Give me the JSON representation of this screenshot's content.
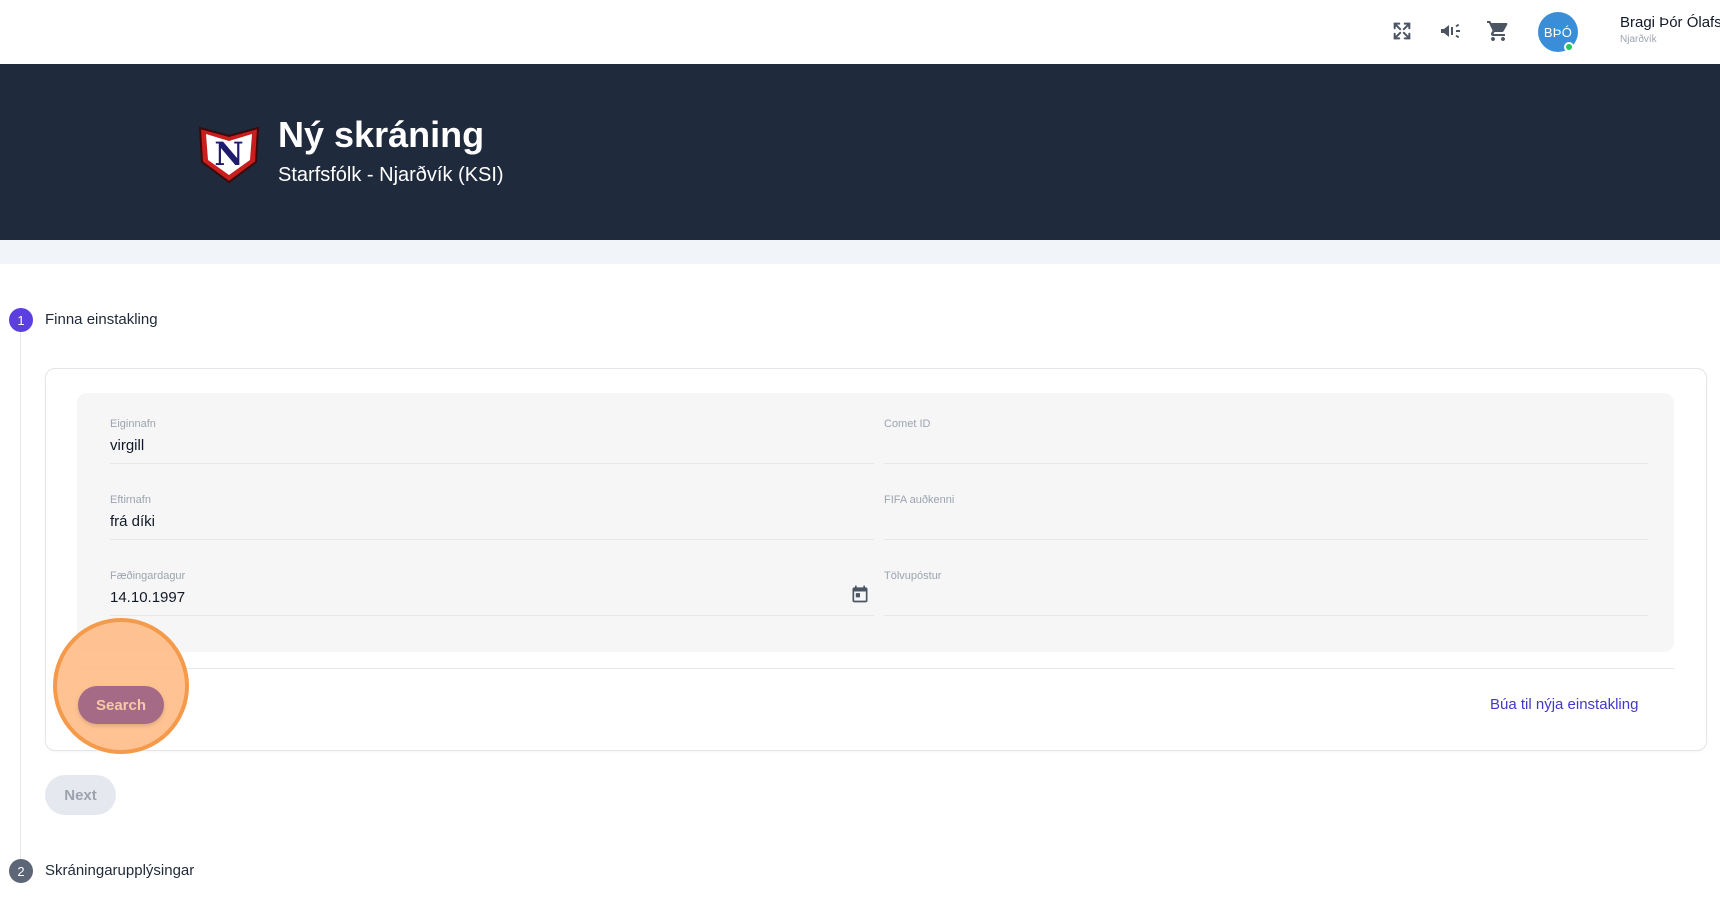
{
  "topbar": {
    "icons": [
      "fullscreen-icon",
      "megaphone-icon",
      "cart-icon"
    ],
    "user": {
      "initials": "BÞÓ",
      "name": "Bragi Þór Ólafs",
      "club": "Njarðvík"
    }
  },
  "header": {
    "title": "Ný skráning",
    "subtitle": "Starfsfólk - Njarðvík (KSI)",
    "logo_letter": "N"
  },
  "steps": [
    {
      "number": "1",
      "label": "Finna einstakling",
      "active": true
    },
    {
      "number": "2",
      "label": "Skráningarupplýsingar",
      "active": false
    }
  ],
  "form": {
    "first_name": {
      "label": "Eiginnafn",
      "value": "virgill"
    },
    "comet_id": {
      "label": "Comet ID",
      "value": ""
    },
    "last_name": {
      "label": "Eftirnafn",
      "value": "frá díki"
    },
    "fifa_id": {
      "label": "FIFA auðkenni",
      "value": ""
    },
    "birthdate": {
      "label": "Fæðingardagur",
      "value": "14.10.1997"
    },
    "email": {
      "label": "Tölvupóstur",
      "value": ""
    }
  },
  "actions": {
    "search_label": "Search",
    "create_label": "Búa til nýja einstakling",
    "next_label": "Next"
  },
  "colors": {
    "header_bg": "#1f2a3d",
    "step_active": "#5b3fe0",
    "link": "#4338ca",
    "highlight": "#f59a4a"
  }
}
